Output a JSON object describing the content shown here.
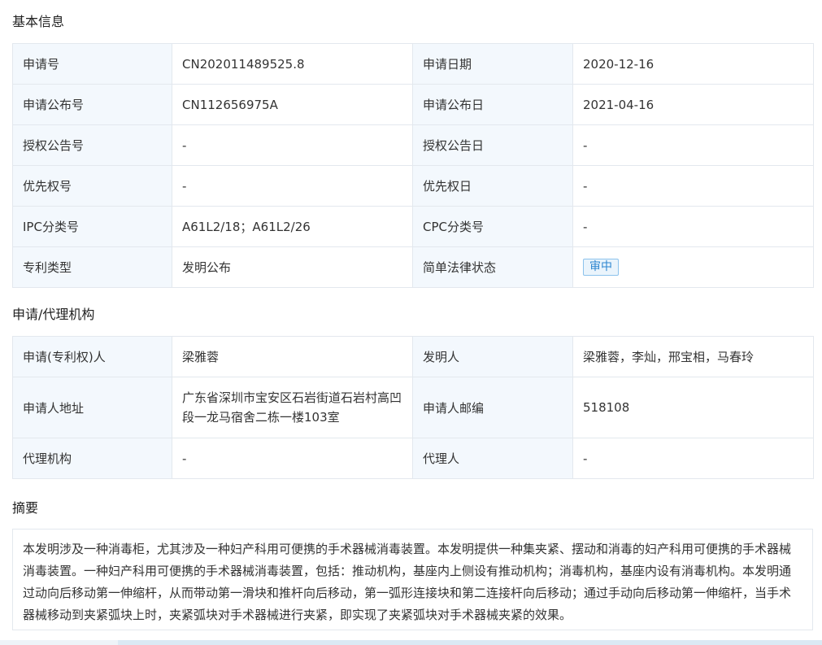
{
  "sections": {
    "basic": "基本信息",
    "applicant": "申请/代理机构",
    "abstract": "摘要"
  },
  "basic": [
    [
      {
        "label": "申请号",
        "value": "CN202011489525.8"
      },
      {
        "label": "申请日期",
        "value": "2020-12-16"
      }
    ],
    [
      {
        "label": "申请公布号",
        "value": "CN112656975A"
      },
      {
        "label": "申请公布日",
        "value": "2021-04-16"
      }
    ],
    [
      {
        "label": "授权公告号",
        "value": "-"
      },
      {
        "label": "授权公告日",
        "value": "-"
      }
    ],
    [
      {
        "label": "优先权号",
        "value": "-"
      },
      {
        "label": "优先权日",
        "value": "-"
      }
    ],
    [
      {
        "label": "IPC分类号",
        "value": "A61L2/18；A61L2/26"
      },
      {
        "label": "CPC分类号",
        "value": "-"
      }
    ],
    [
      {
        "label": "专利类型",
        "value": "发明公布"
      },
      {
        "label": "简单法律状态",
        "value": "审中"
      }
    ]
  ],
  "applicant": [
    [
      {
        "label": "申请(专利权)人",
        "value": "梁雅蓉"
      },
      {
        "label": "发明人",
        "value": "梁雅蓉，李灿，邢宝相，马春玲"
      }
    ],
    [
      {
        "label": "申请人地址",
        "value": "广东省深圳市宝安区石岩街道石岩村高凹段一龙马宿舍二栋一楼103室"
      },
      {
        "label": "申请人邮编",
        "value": "518108"
      }
    ],
    [
      {
        "label": "代理机构",
        "value": "-"
      },
      {
        "label": "代理人",
        "value": "-"
      }
    ]
  ],
  "abstract_text": "本发明涉及一种消毒柜，尤其涉及一种妇产科用可便携的手术器械消毒装置。本发明提供一种集夹紧、摆动和消毒的妇产科用可便携的手术器械消毒装置。一种妇产科用可便携的手术器械消毒装置，包括：推动机构，基座内上侧设有推动机构；消毒机构，基座内设有消毒机构。本发明通过动向后移动第一伸缩杆，从而带动第一滑块和推杆向后移动，第一弧形连接块和第二连接杆向后移动；通过手动向后移动第一伸缩杆，当手术器械移动到夹紧弧块上时，夹紧弧块对手术器械进行夹紧，即实现了夹紧弧块对手术器械夹紧的效果。",
  "colors": {
    "label_bg": "#f3f8fd",
    "border": "#e3e8ee",
    "badge_text": "#2f86d0",
    "badge_border": "#8cc2ec"
  }
}
